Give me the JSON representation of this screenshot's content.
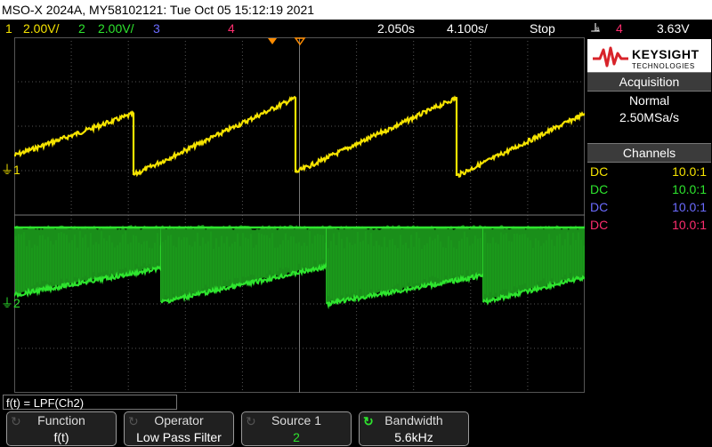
{
  "title": "MSO-X 2024A, MY58102121: Tue Oct 05 15:12:19 2021",
  "status": {
    "ch1": {
      "num": "1",
      "scale": "2.00V/"
    },
    "ch2": {
      "num": "2",
      "scale": "2.00V/"
    },
    "ch3": {
      "num": "3"
    },
    "ch4": {
      "num": "4"
    },
    "time_delay": "2.050s",
    "time_scale": "4.100s/",
    "run_state": "Stop",
    "trigger_icon": "trigger-edge-icon",
    "trigger_source": "4",
    "trigger_level": "3.63V"
  },
  "markers": {
    "ch1": "1",
    "ch2": "2"
  },
  "logo": {
    "name": "KEYSIGHT",
    "sub": "TECHNOLOGIES"
  },
  "acquisition": {
    "header": "Acquisition",
    "mode": "Normal",
    "rate": "2.50MSa/s"
  },
  "channels": {
    "header": "Channels",
    "rows": [
      {
        "coupling": "DC",
        "probe": "10.0:1",
        "color": "#f5e300"
      },
      {
        "coupling": "DC",
        "probe": "10.0:1",
        "color": "#2ee52e"
      },
      {
        "coupling": "DC",
        "probe": "10.0:1",
        "color": "#6b6bff"
      },
      {
        "coupling": "DC",
        "probe": "10.0:1",
        "color": "#ff2d6e"
      }
    ]
  },
  "math_formula": "f(t) = LPF(Ch2)",
  "softkeys": [
    {
      "title": "Function",
      "value": "f(t)",
      "active": false
    },
    {
      "title": "Operator",
      "value": "Low Pass Filter",
      "active": false
    },
    {
      "title": "Source 1",
      "value": "2",
      "active": false
    },
    {
      "title": "Bandwidth",
      "value": "5.6kHz",
      "active": true
    }
  ],
  "colors": {
    "ch1": "#f5e300",
    "ch2": "#2ee52e",
    "ch3": "#6b6bff",
    "ch4": "#ff2d6e",
    "grid": "#555555",
    "trigger_marker": "#ff8c00"
  }
}
